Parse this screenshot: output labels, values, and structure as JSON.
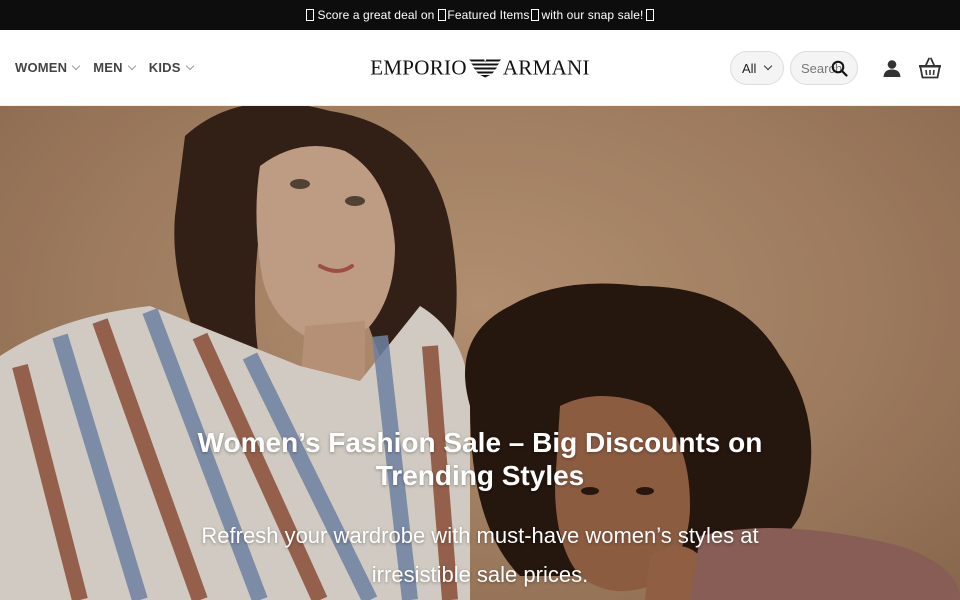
{
  "announcement": {
    "text_1": "Score a great deal on",
    "text_2": "Featured Items",
    "text_3": "with our snap sale!"
  },
  "nav": {
    "items": [
      {
        "label": "WOMEN"
      },
      {
        "label": "MEN"
      },
      {
        "label": "KIDS"
      }
    ]
  },
  "logo": {
    "left_text": "EMPORIO",
    "right_text": "ARMANI"
  },
  "search": {
    "category_selected": "All",
    "placeholder": "Search"
  },
  "icons": {
    "account": "user-icon",
    "cart": "basket-icon",
    "search": "search-icon"
  },
  "hero": {
    "title": "Women’s Fashion Sale – Big Discounts on Trending Styles",
    "subtitle": "Refresh your wardrobe with must-have women’s styles at irresistible sale prices."
  },
  "colors": {
    "topbar_bg": "#0d0d0d",
    "hero_bg": "#b48d6c",
    "text_white": "#ffffff"
  }
}
